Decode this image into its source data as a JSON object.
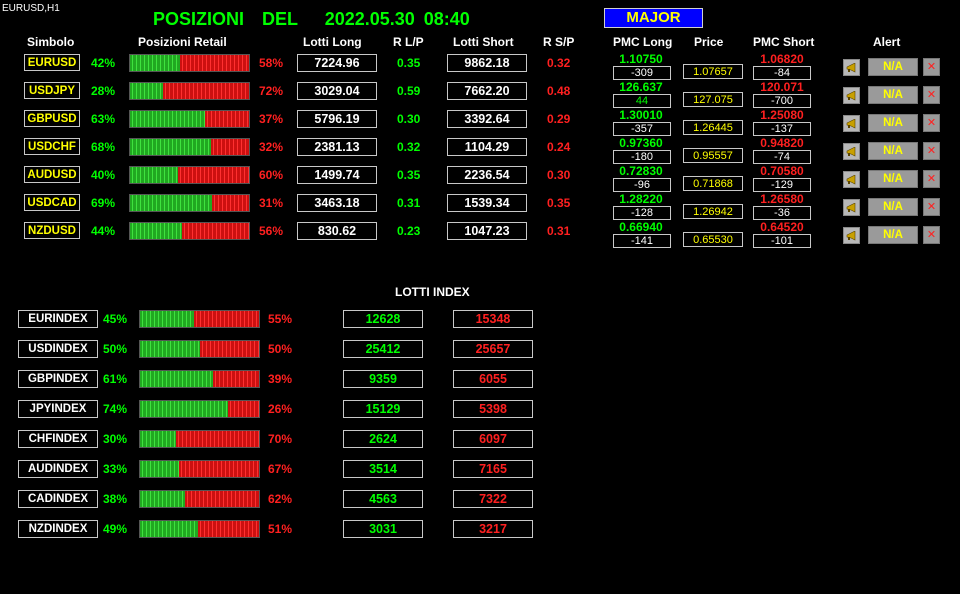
{
  "window": {
    "label": "EURUSD,H1"
  },
  "header": {
    "title": "POSIZIONI  DEL   2022.05.30 08:40",
    "group_button": "MAJOR"
  },
  "columns": {
    "symbol": "Simbolo",
    "retail": "Posizioni Retail",
    "lots_long": "Lotti Long",
    "r_lp": "R L/P",
    "lots_short": "Lotti Short",
    "r_sp": "R S/P",
    "pmc_long": "PMC Long",
    "price": "Price",
    "pmc_short": "PMC Short",
    "alert": "Alert"
  },
  "pairs": [
    {
      "symbol": "EURUSD",
      "long_pct": "42%",
      "long_frac": 0.42,
      "short_pct": "58%",
      "lots_long": "7224.96",
      "r_lp": "0.35",
      "lots_short": "9862.18",
      "r_sp": "0.32",
      "pmc_long": "1.10750",
      "pmc_long_pips": "-309",
      "price": "1.07657",
      "pmc_short": "1.06820",
      "pmc_short_pips": "-84",
      "alert": "N/A"
    },
    {
      "symbol": "USDJPY",
      "long_pct": "28%",
      "long_frac": 0.28,
      "short_pct": "72%",
      "lots_long": "3029.04",
      "r_lp": "0.59",
      "lots_short": "7662.20",
      "r_sp": "0.48",
      "pmc_long": "126.637",
      "pmc_long_pips": "44",
      "price": "127.075",
      "pmc_short": "120.071",
      "pmc_short_pips": "-700",
      "alert": "N/A"
    },
    {
      "symbol": "GBPUSD",
      "long_pct": "63%",
      "long_frac": 0.63,
      "short_pct": "37%",
      "lots_long": "5796.19",
      "r_lp": "0.30",
      "lots_short": "3392.64",
      "r_sp": "0.29",
      "pmc_long": "1.30010",
      "pmc_long_pips": "-357",
      "price": "1.26445",
      "pmc_short": "1.25080",
      "pmc_short_pips": "-137",
      "alert": "N/A"
    },
    {
      "symbol": "USDCHF",
      "long_pct": "68%",
      "long_frac": 0.68,
      "short_pct": "32%",
      "lots_long": "2381.13",
      "r_lp": "0.32",
      "lots_short": "1104.29",
      "r_sp": "0.24",
      "pmc_long": "0.97360",
      "pmc_long_pips": "-180",
      "price": "0.95557",
      "pmc_short": "0.94820",
      "pmc_short_pips": "-74",
      "alert": "N/A"
    },
    {
      "symbol": "AUDUSD",
      "long_pct": "40%",
      "long_frac": 0.4,
      "short_pct": "60%",
      "lots_long": "1499.74",
      "r_lp": "0.35",
      "lots_short": "2236.54",
      "r_sp": "0.30",
      "pmc_long": "0.72830",
      "pmc_long_pips": "-96",
      "price": "0.71868",
      "pmc_short": "0.70580",
      "pmc_short_pips": "-129",
      "alert": "N/A"
    },
    {
      "symbol": "USDCAD",
      "long_pct": "69%",
      "long_frac": 0.69,
      "short_pct": "31%",
      "lots_long": "3463.18",
      "r_lp": "0.31",
      "lots_short": "1539.34",
      "r_sp": "0.35",
      "pmc_long": "1.28220",
      "pmc_long_pips": "-128",
      "price": "1.26942",
      "pmc_short": "1.26580",
      "pmc_short_pips": "-36",
      "alert": "N/A"
    },
    {
      "symbol": "NZDUSD",
      "long_pct": "44%",
      "long_frac": 0.44,
      "short_pct": "56%",
      "lots_long": "830.62",
      "r_lp": "0.23",
      "lots_short": "1047.23",
      "r_sp": "0.31",
      "pmc_long": "0.66940",
      "pmc_long_pips": "-141",
      "price": "0.65530",
      "pmc_short": "0.64520",
      "pmc_short_pips": "-101",
      "alert": "N/A"
    }
  ],
  "index_section": {
    "title": "LOTTI INDEX"
  },
  "indices": [
    {
      "symbol": "EURINDEX",
      "long_pct": "45%",
      "long_frac": 0.45,
      "short_pct": "55%",
      "lots_long": "12628",
      "lots_short": "15348"
    },
    {
      "symbol": "USDINDEX",
      "long_pct": "50%",
      "long_frac": 0.5,
      "short_pct": "50%",
      "lots_long": "25412",
      "lots_short": "25657"
    },
    {
      "symbol": "GBPINDEX",
      "long_pct": "61%",
      "long_frac": 0.61,
      "short_pct": "39%",
      "lots_long": "9359",
      "lots_short": "6055"
    },
    {
      "symbol": "JPYINDEX",
      "long_pct": "74%",
      "long_frac": 0.74,
      "short_pct": "26%",
      "lots_long": "15129",
      "lots_short": "5398"
    },
    {
      "symbol": "CHFINDEX",
      "long_pct": "30%",
      "long_frac": 0.3,
      "short_pct": "70%",
      "lots_long": "2624",
      "lots_short": "6097"
    },
    {
      "symbol": "AUDINDEX",
      "long_pct": "33%",
      "long_frac": 0.33,
      "short_pct": "67%",
      "lots_long": "3514",
      "lots_short": "7165"
    },
    {
      "symbol": "CADINDEX",
      "long_pct": "38%",
      "long_frac": 0.38,
      "short_pct": "62%",
      "lots_long": "4563",
      "lots_short": "7322"
    },
    {
      "symbol": "NZDINDEX",
      "long_pct": "49%",
      "long_frac": 0.49,
      "short_pct": "51%",
      "lots_long": "3031",
      "lots_short": "3217"
    }
  ],
  "colors": {
    "background": "#000000",
    "long": "#00ff00",
    "short": "#ff2020",
    "symbol_text": "#ffff00",
    "group_button_bg": "#0000ff"
  },
  "icons": {
    "alert_icon": "megaphone-icon",
    "remove_icon": "close-icon"
  }
}
